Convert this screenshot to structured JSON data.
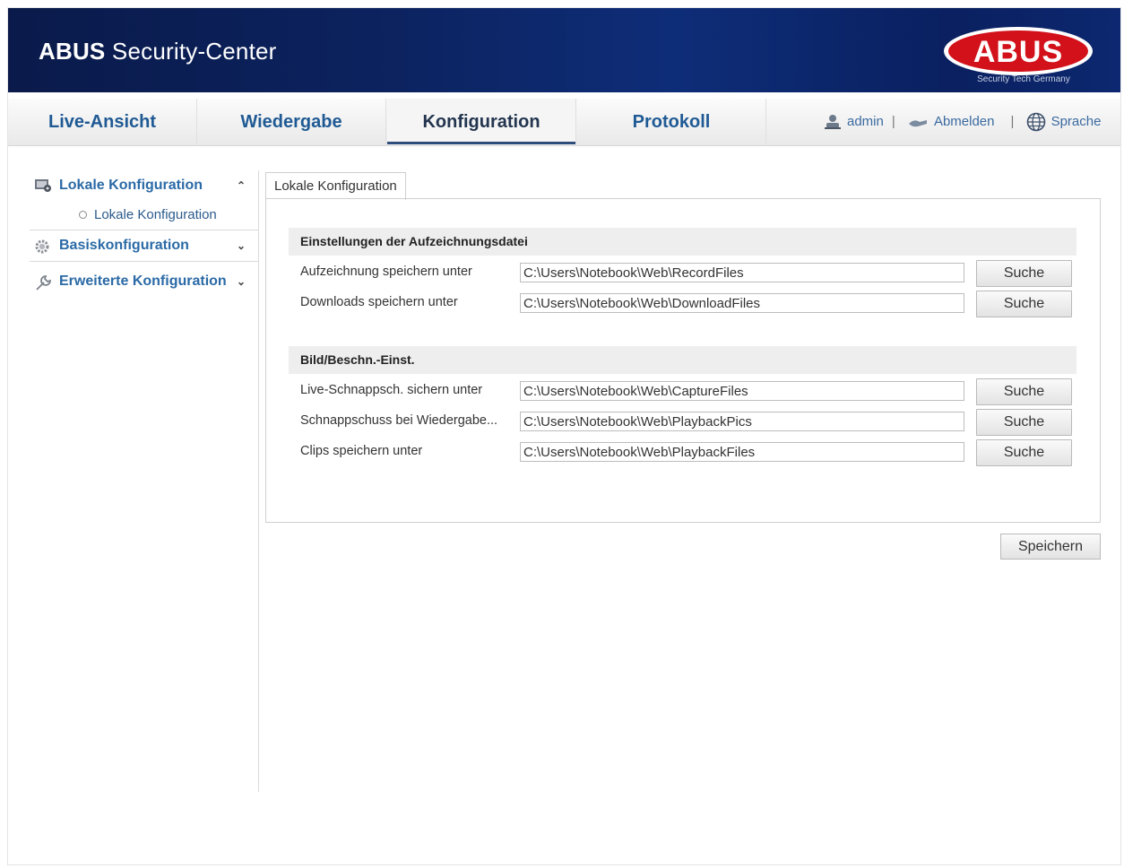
{
  "header": {
    "title_bold": "ABUS",
    "title_rest": "Security-Center",
    "logo_text": "ABUS",
    "logo_tagline": "Security Tech Germany"
  },
  "nav": {
    "tabs": [
      {
        "label": "Live-Ansicht",
        "active": false
      },
      {
        "label": "Wiedergabe",
        "active": false
      },
      {
        "label": "Konfiguration",
        "active": true
      },
      {
        "label": "Protokoll",
        "active": false
      }
    ],
    "user": {
      "name": "admin",
      "logout": "Abmelden",
      "language": "Sprache",
      "separator": "|"
    }
  },
  "sidebar": {
    "sections": [
      {
        "label": "Lokale Konfiguration",
        "icon": "local-config-icon",
        "expanded": true,
        "children": [
          {
            "label": "Lokale Konfiguration"
          }
        ]
      },
      {
        "label": "Basiskonfiguration",
        "icon": "gear-icon",
        "expanded": false
      },
      {
        "label": "Erweiterte Konfiguration",
        "icon": "wrench-icon",
        "expanded": false
      }
    ]
  },
  "content": {
    "tab_label": "Lokale Konfiguration",
    "section1": {
      "title": "Einstellungen der Aufzeichnungsdatei",
      "rows": [
        {
          "label": "Aufzeichnung speichern unter",
          "value": "C:\\Users\\Notebook\\Web\\RecordFiles",
          "button": "Suche"
        },
        {
          "label": "Downloads speichern unter",
          "value": "C:\\Users\\Notebook\\Web\\DownloadFiles",
          "button": "Suche"
        }
      ]
    },
    "section2": {
      "title": "Bild/Beschn.-Einst.",
      "rows": [
        {
          "label": "Live-Schnappsch. sichern unter",
          "value": "C:\\Users\\Notebook\\Web\\CaptureFiles",
          "button": "Suche"
        },
        {
          "label": "Schnappschuss bei Wiedergabe...",
          "value": "C:\\Users\\Notebook\\Web\\PlaybackPics",
          "button": "Suche"
        },
        {
          "label": "Clips speichern unter",
          "value": "C:\\Users\\Notebook\\Web\\PlaybackFiles",
          "button": "Suche"
        }
      ]
    },
    "save_label": "Speichern"
  },
  "colors": {
    "header_bg": "#0c2360",
    "nav_text": "#1f5a94",
    "logo_red": "#d2111a",
    "link": "#2b6aa6"
  }
}
